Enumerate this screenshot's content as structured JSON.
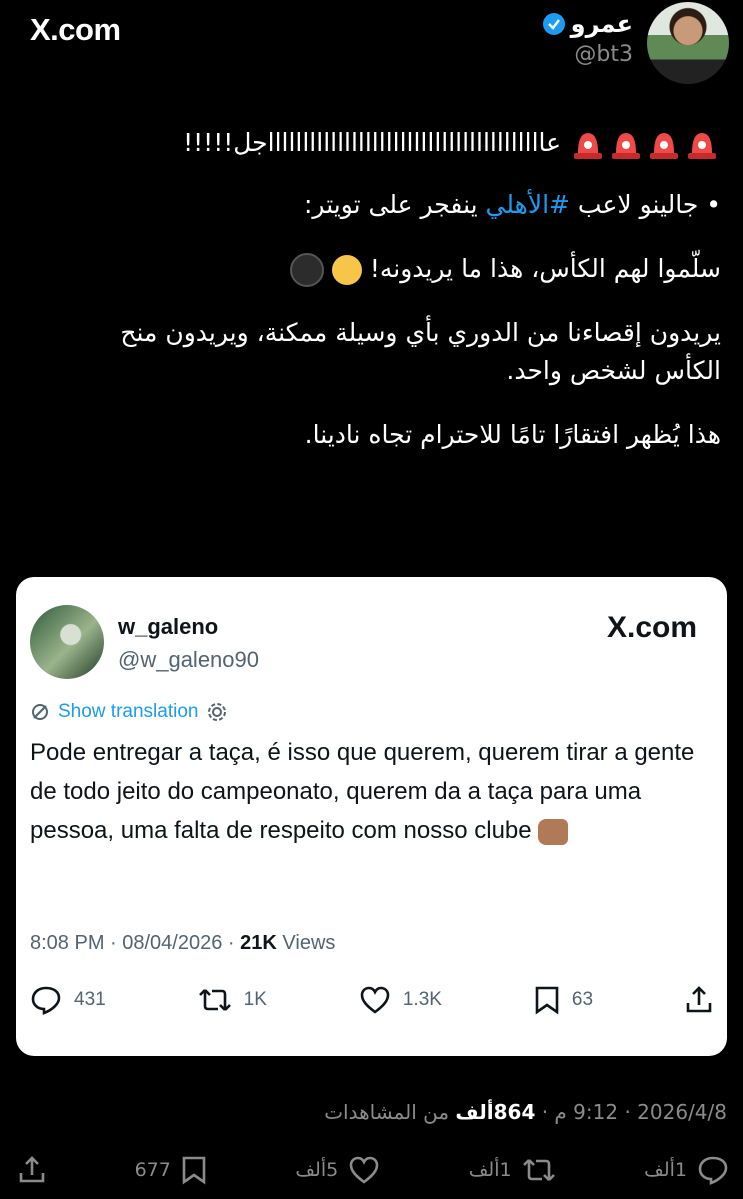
{
  "brand": "X.com",
  "author": {
    "name": "عمرو",
    "handle": "@bt3"
  },
  "tweet": {
    "line1": "عااااااااااااااااااااااااااااااااااااااااجل!!!!!",
    "line2_prefix": "• جالينو لاعب ",
    "hashtag": "#الأهلي",
    "line2_suffix": " ينفجر على تويتر:",
    "line3": "سلّموا لهم الكأس، هذا ما يريدونه!",
    "line4": "يريدون إقصاءنا من الدوري بأي وسيلة ممكنة، ويريدون منح الكأس لشخص واحد.",
    "line5": "هذا يُظهر افتقارًا تامًا للاحترام تجاه نادينا."
  },
  "quoted": {
    "name": "w_galeno",
    "handle": "@w_galeno90",
    "brand": "X.com",
    "show_translation": "Show translation",
    "text": "Pode entregar a taça, é isso que querem, querem tirar a gente de todo jeito do campeonato, querem da a taça para uma pessoa, uma falta de respeito com nosso clube",
    "time": "8:08 PM · 08/04/2026 · ",
    "views_count": "21K",
    "views_label": " Views",
    "replies": "431",
    "reposts": "1K",
    "likes": "1.3K",
    "bookmarks": "63"
  },
  "footer": {
    "date": "2026/4/8 · 9:12 م · ",
    "views": "864ألف",
    "views_label": " من المشاهدات",
    "replies": "1ألف",
    "reposts": "1ألف",
    "likes": "5ألف",
    "bookmarks": "677"
  },
  "colors": {
    "accent": "#1d9bf0",
    "bg": "#000000",
    "card_bg": "#ffffff"
  }
}
